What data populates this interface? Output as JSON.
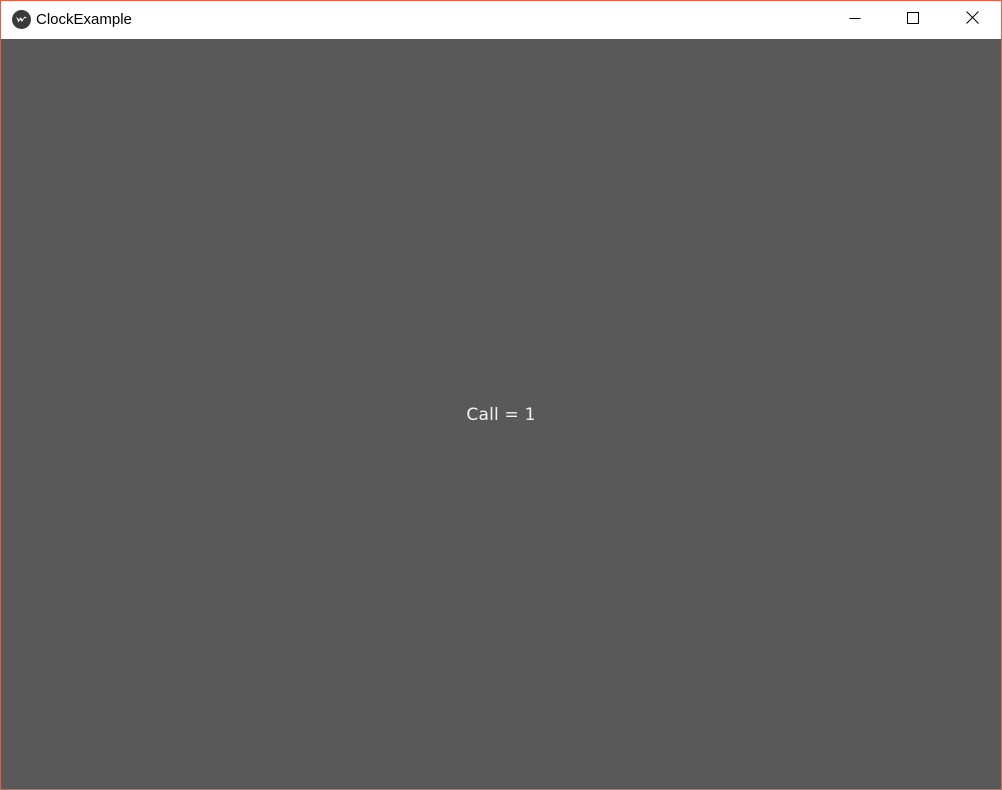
{
  "window": {
    "title": "ClockExample",
    "border_color": "#e0634c",
    "app_icon": "kivy-logo-icon"
  },
  "titlebar": {
    "controls": [
      {
        "name": "minimize",
        "icon": "minimize-icon"
      },
      {
        "name": "maximize",
        "icon": "maximize-icon"
      },
      {
        "name": "close",
        "icon": "close-icon"
      }
    ]
  },
  "content": {
    "background": "#595959",
    "label_text": "Call = 1",
    "label_color": "#f2f2f2"
  }
}
